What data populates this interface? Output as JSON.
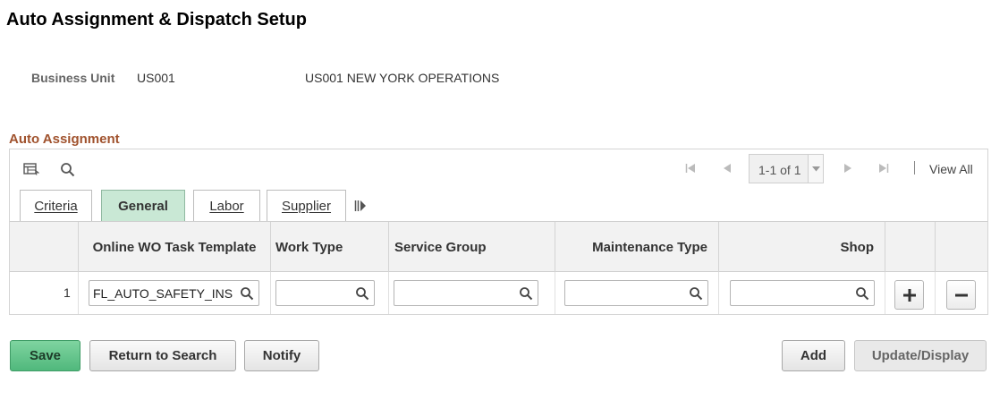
{
  "page": {
    "title": "Auto Assignment & Dispatch Setup"
  },
  "business_unit": {
    "label": "Business Unit",
    "code": "US001",
    "description": "US001 NEW YORK OPERATIONS"
  },
  "section": {
    "title": "Auto Assignment"
  },
  "grid": {
    "toolbar": {
      "personalize_icon": "grid-settings-icon",
      "find_icon": "search-icon"
    },
    "pager": {
      "text": "1-1 of 1",
      "view_all": "View All"
    },
    "tabs": [
      {
        "label": "Criteria",
        "active": false
      },
      {
        "label": "General",
        "active": true
      },
      {
        "label": "Labor",
        "active": false
      },
      {
        "label": "Supplier",
        "active": false
      }
    ],
    "columns": [
      "Online WO Task Template",
      "Work Type",
      "Service Group",
      "Maintenance Type",
      "Shop"
    ],
    "rows": [
      {
        "num": "1",
        "task_template": "FL_AUTO_SAFETY_INS",
        "work_type": "",
        "service_group": "",
        "maintenance_type": "",
        "shop": ""
      }
    ]
  },
  "buttons": {
    "save": "Save",
    "return_to_search": "Return to Search",
    "notify": "Notify",
    "add": "Add",
    "update_display": "Update/Display"
  },
  "colors": {
    "section_title": "#a0522d",
    "active_tab": "#c9e8d5",
    "save_button": "#5fc289"
  }
}
